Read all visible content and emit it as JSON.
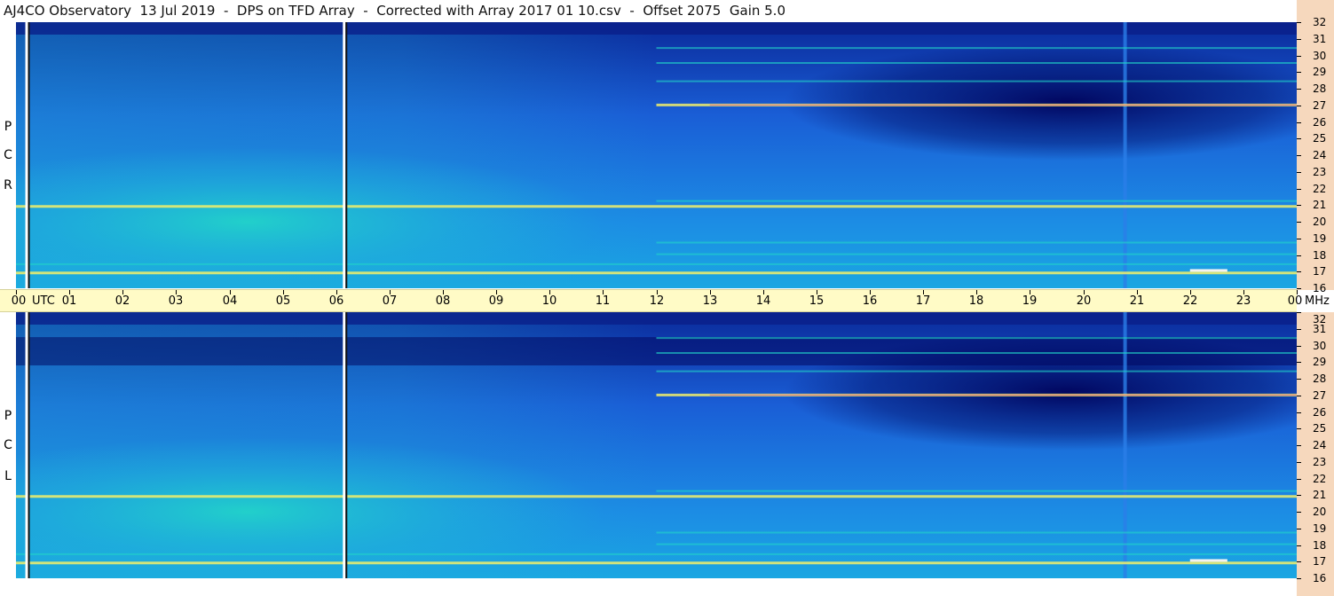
{
  "title": "AJ4CO Observatory  13 Jul 2019  -  DPS on TFD Array  -  Corrected with Array 2017 01 10.csv  -  Offset 2075  Gain 5.0",
  "chart_data": {
    "type": "heatmap",
    "title": "AJ4CO Observatory  13 Jul 2019  -  DPS on TFD Array  -  Corrected with Array 2017 01 10.csv  -  Offset 2075  Gain 5.0",
    "x_axis": {
      "unit_label": "UTC",
      "tick_labels": [
        "00",
        "01",
        "02",
        "03",
        "04",
        "05",
        "06",
        "07",
        "08",
        "09",
        "10",
        "11",
        "12",
        "13",
        "14",
        "15",
        "16",
        "17",
        "18",
        "19",
        "20",
        "21",
        "22",
        "23",
        "00"
      ],
      "range_hours": [
        0,
        24
      ]
    },
    "y_axis": {
      "unit_label": "MHz",
      "tick_labels": [
        "32",
        "31",
        "30",
        "29",
        "28",
        "27",
        "26",
        "25",
        "24",
        "23",
        "22",
        "21",
        "20",
        "19",
        "18",
        "17",
        "16"
      ],
      "range_mhz": [
        16,
        32
      ]
    },
    "panels": [
      {
        "name": "RCP",
        "label_letters": [
          "P",
          "C",
          "R"
        ]
      },
      {
        "name": "LCP",
        "label_letters": [
          "P",
          "C",
          "L"
        ]
      }
    ],
    "markers_utc_hours": [
      0.2,
      6.15
    ],
    "interference_bands_mhz": [
      17.0,
      17.5,
      18.1,
      18.8,
      21.0,
      21.3,
      27.1,
      28.5,
      29.6,
      30.5
    ],
    "colors": {
      "low": "#00025a",
      "mid": "#1558d8",
      "high": "#22d6c8",
      "peak": "#f2ee6a",
      "marker": "#ffffff"
    }
  }
}
